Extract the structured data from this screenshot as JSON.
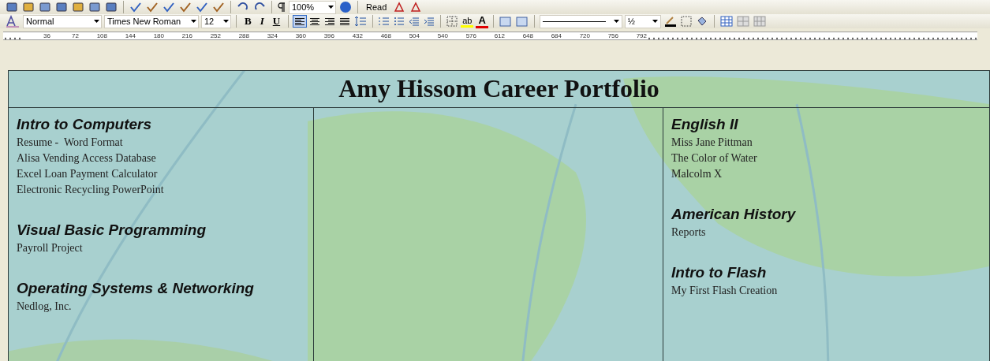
{
  "standard_toolbar": {
    "zoom": "100%",
    "read_button": "Read"
  },
  "formatting_toolbar": {
    "style": "Normal",
    "font": "Times New Roman",
    "size": "12",
    "bold": "B",
    "italic": "I",
    "underline": "U",
    "alignments": [
      {
        "selected": true
      },
      {
        "selected": false
      },
      {
        "selected": false
      },
      {
        "selected": false
      }
    ],
    "highlight": "ab",
    "font_color": "A",
    "line_weight": "½"
  },
  "ruler": {
    "ticks": [
      "36",
      "72",
      "108",
      "144",
      "180",
      "216",
      "252",
      "288",
      "324",
      "360",
      "396",
      "432",
      "468",
      "504",
      "540",
      "576",
      "612",
      "648",
      "684",
      "720",
      "756",
      "792"
    ]
  },
  "document": {
    "title": "Amy Hissom Career Portfolio",
    "left_column": [
      {
        "heading": "Intro to Computers",
        "items": [
          "Resume -  Word Format",
          "Alisa Vending Access Database",
          "Excel Loan Payment Calculator",
          "Electronic Recycling PowerPoint"
        ]
      },
      {
        "heading": "Visual Basic Programming",
        "items": [
          "Payroll Project"
        ]
      },
      {
        "heading": "Operating Systems & Networking",
        "items": [
          "Nedlog, Inc."
        ]
      }
    ],
    "right_column": [
      {
        "heading": "English II",
        "items": [
          "Miss Jane Pittman",
          "The Color of Water",
          "Malcolm X"
        ]
      },
      {
        "heading": "American History",
        "items": [
          "Reports"
        ]
      },
      {
        "heading": "Intro to Flash",
        "items": [
          "My First Flash Creation"
        ]
      }
    ]
  }
}
